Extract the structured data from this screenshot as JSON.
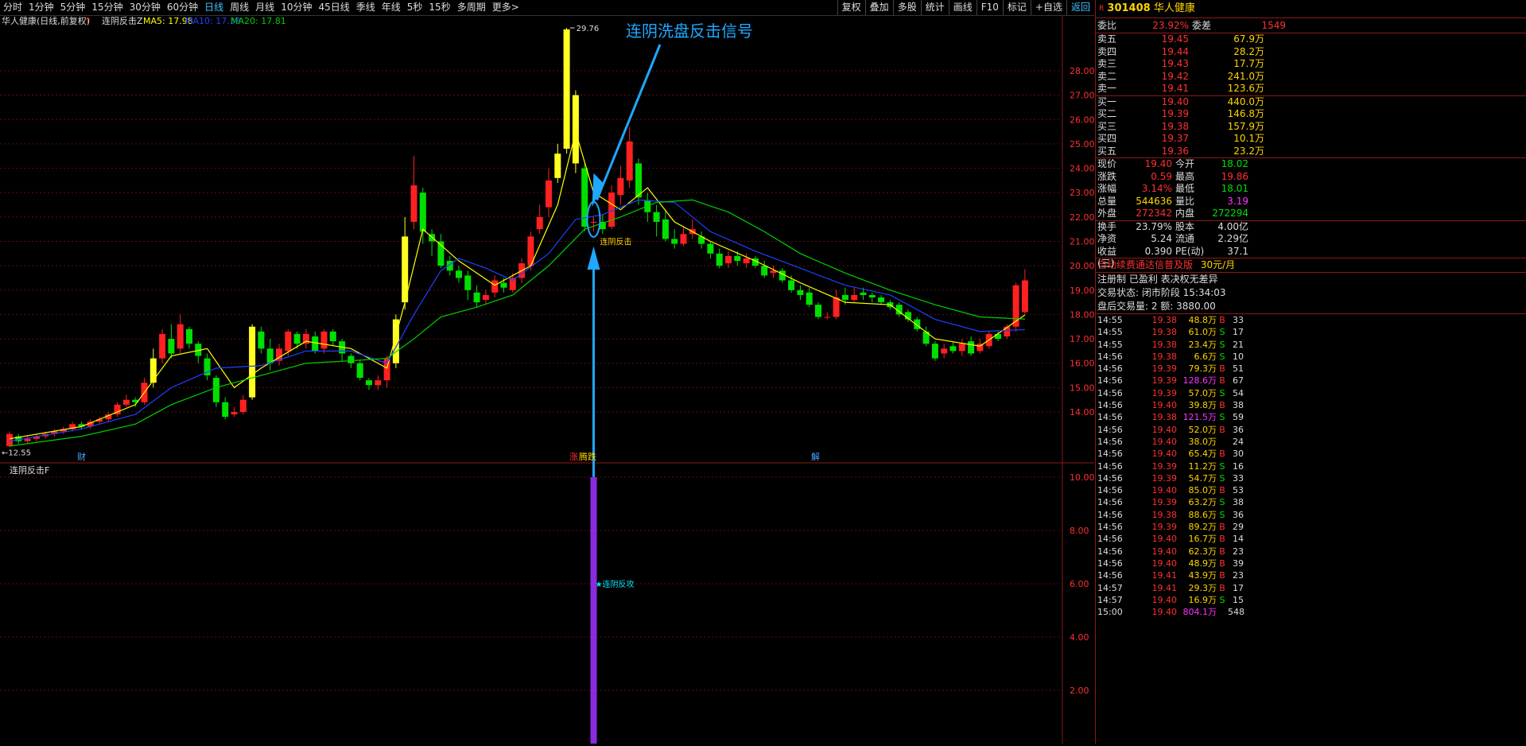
{
  "toolbar": {
    "periods": [
      "分时",
      "1分钟",
      "5分钟",
      "15分钟",
      "30分钟",
      "60分钟",
      "日线",
      "周线",
      "月线",
      "10分钟",
      "45日线",
      "季线",
      "年线",
      "5秒",
      "15秒",
      "多周期",
      "更多>"
    ],
    "active_period": "日线",
    "right_buttons": [
      "复权",
      "叠加",
      "多股",
      "统计",
      "画线",
      "F10",
      "标记",
      "+自选",
      "返回"
    ]
  },
  "chart": {
    "header_stock": "华人健康(日线,前复权)",
    "header_indicator": "连阴反击Z",
    "ma5_label": "MA5: 17.98",
    "ma10_label": "MA10: 17.38",
    "ma20_label": "MA20: 17.81",
    "high_label": "29.76",
    "low_label": "12.55",
    "signal_label": "连阴反击",
    "annotation_title": "连阴洗盘反击信号",
    "marker_cai": "财",
    "marker_zhang": "涨",
    "marker_sheng": "腾跌",
    "marker_jie": "解",
    "price_ticks": [
      "28.00",
      "27.00",
      "26.00",
      "25.00",
      "24.00",
      "23.00",
      "22.00",
      "21.00",
      "20.00",
      "19.00",
      "18.00",
      "17.00",
      "16.00",
      "15.00",
      "14.00"
    ],
    "sub_indicator": "连阴反击F",
    "sub_signal_label": "连阴反攻",
    "sub_ticks": [
      "10.00",
      "8.00",
      "6.00",
      "4.00",
      "2.00"
    ],
    "colors": {
      "ma5": "#ffff00",
      "ma10": "#2040ff",
      "ma20": "#00d000",
      "up": "#ff2020",
      "down": "#00e000",
      "special": "#ffff20",
      "signal": "#1fa8ff",
      "bar": "#8a2be2"
    }
  },
  "chart_data": {
    "type": "candlestick",
    "title": "华人健康(日线,前复权)",
    "ylim": [
      12.0,
      30.0
    ],
    "high": 29.76,
    "low": 12.55,
    "ma": {
      "MA5": 17.98,
      "MA10": 17.38,
      "MA20": 17.81
    },
    "sub_indicator": {
      "name": "连阴反击F",
      "ylim": [
        0,
        10
      ],
      "signal_value": 10,
      "signal_label": "连阴反攻"
    }
  },
  "panel": {
    "code": "301408",
    "name": "华人健康",
    "weibi_label": "委比",
    "weibi": "23.92%",
    "weicha_label": "委差",
    "weicha": "1549",
    "asks": [
      {
        "label": "卖五",
        "price": "19.45",
        "vol": "67.9万"
      },
      {
        "label": "卖四",
        "price": "19.44",
        "vol": "28.2万"
      },
      {
        "label": "卖三",
        "price": "19.43",
        "vol": "17.7万"
      },
      {
        "label": "卖二",
        "price": "19.42",
        "vol": "241.0万"
      },
      {
        "label": "卖一",
        "price": "19.41",
        "vol": "123.6万"
      }
    ],
    "bids": [
      {
        "label": "买一",
        "price": "19.40",
        "vol": "440.0万"
      },
      {
        "label": "买二",
        "price": "19.39",
        "vol": "146.8万"
      },
      {
        "label": "买三",
        "price": "19.38",
        "vol": "157.9万"
      },
      {
        "label": "买四",
        "price": "19.37",
        "vol": "10.1万"
      },
      {
        "label": "买五",
        "price": "19.36",
        "vol": "23.2万"
      }
    ],
    "quote": [
      {
        "l1": "现价",
        "v1": "19.40",
        "c1": "red",
        "l2": "今开",
        "v2": "18.02",
        "c2": "green"
      },
      {
        "l1": "涨跌",
        "v1": "0.59",
        "c1": "red",
        "l2": "最高",
        "v2": "19.86",
        "c2": "red"
      },
      {
        "l1": "涨幅",
        "v1": "3.14%",
        "c1": "red",
        "l2": "最低",
        "v2": "18.01",
        "c2": "green"
      },
      {
        "l1": "总量",
        "v1": "544636",
        "c1": "yellow",
        "l2": "量比",
        "v2": "3.19",
        "c2": "magenta"
      },
      {
        "l1": "外盘",
        "v1": "272342",
        "c1": "red",
        "l2": "内盘",
        "v2": "272294",
        "c2": "green"
      }
    ],
    "quote2": [
      {
        "l1": "换手",
        "v1": "23.79%",
        "l2": "股本",
        "v2": "4.00亿"
      },
      {
        "l1": "净资",
        "v1": "5.24",
        "l2": "流通",
        "v2": "2.29亿"
      },
      {
        "l1": "收益(三)",
        "v1": "0.390",
        "l2": "PE(动)",
        "v2": "37.1"
      }
    ],
    "promo": "自动续费通达信普及版",
    "promo_price": "30元/月",
    "reg_line": "注册制 已盈利 表决权无差异",
    "trade_status": "交易状态: 闭市阶段 15:34:03",
    "after_hours": "盘后交易量: 2 额: 3880.00",
    "ticks": [
      {
        "t": "14:55",
        "p": "19.38",
        "v": "48.8万",
        "bs": "B",
        "n": "33"
      },
      {
        "t": "14:55",
        "p": "19.38",
        "v": "61.0万",
        "bs": "S",
        "n": "17"
      },
      {
        "t": "14:55",
        "p": "19.38",
        "v": "23.4万",
        "bs": "S",
        "n": "21"
      },
      {
        "t": "14:56",
        "p": "19.38",
        "v": "6.6万",
        "bs": "S",
        "n": "10"
      },
      {
        "t": "14:56",
        "p": "19.39",
        "v": "79.3万",
        "bs": "B",
        "n": "51"
      },
      {
        "t": "14:56",
        "p": "19.39",
        "v": "128.6万",
        "bs": "B",
        "n": "67"
      },
      {
        "t": "14:56",
        "p": "19.39",
        "v": "57.0万",
        "bs": "S",
        "n": "54"
      },
      {
        "t": "14:56",
        "p": "19.40",
        "v": "39.8万",
        "bs": "B",
        "n": "38"
      },
      {
        "t": "14:56",
        "p": "19.38",
        "v": "121.5万",
        "bs": "S",
        "n": "59"
      },
      {
        "t": "14:56",
        "p": "19.40",
        "v": "52.0万",
        "bs": "B",
        "n": "36"
      },
      {
        "t": "14:56",
        "p": "19.40",
        "v": "38.0万",
        "bs": "",
        "n": "24"
      },
      {
        "t": "14:56",
        "p": "19.40",
        "v": "65.4万",
        "bs": "B",
        "n": "30"
      },
      {
        "t": "14:56",
        "p": "19.39",
        "v": "11.2万",
        "bs": "S",
        "n": "16"
      },
      {
        "t": "14:56",
        "p": "19.39",
        "v": "54.7万",
        "bs": "S",
        "n": "33"
      },
      {
        "t": "14:56",
        "p": "19.40",
        "v": "85.0万",
        "bs": "B",
        "n": "53"
      },
      {
        "t": "14:56",
        "p": "19.39",
        "v": "63.2万",
        "bs": "S",
        "n": "38"
      },
      {
        "t": "14:56",
        "p": "19.38",
        "v": "88.6万",
        "bs": "S",
        "n": "36"
      },
      {
        "t": "14:56",
        "p": "19.39",
        "v": "89.2万",
        "bs": "B",
        "n": "29"
      },
      {
        "t": "14:56",
        "p": "19.40",
        "v": "16.7万",
        "bs": "B",
        "n": "14"
      },
      {
        "t": "14:56",
        "p": "19.40",
        "v": "62.3万",
        "bs": "B",
        "n": "23"
      },
      {
        "t": "14:56",
        "p": "19.40",
        "v": "48.9万",
        "bs": "B",
        "n": "39"
      },
      {
        "t": "14:56",
        "p": "19.41",
        "v": "43.9万",
        "bs": "B",
        "n": "23"
      },
      {
        "t": "14:57",
        "p": "19.41",
        "v": "29.3万",
        "bs": "B",
        "n": "17"
      },
      {
        "t": "14:57",
        "p": "19.40",
        "v": "16.9万",
        "bs": "S",
        "n": "15"
      },
      {
        "t": "15:00",
        "p": "19.40",
        "v": "804.1万",
        "bs": "",
        "n": "548"
      }
    ]
  }
}
